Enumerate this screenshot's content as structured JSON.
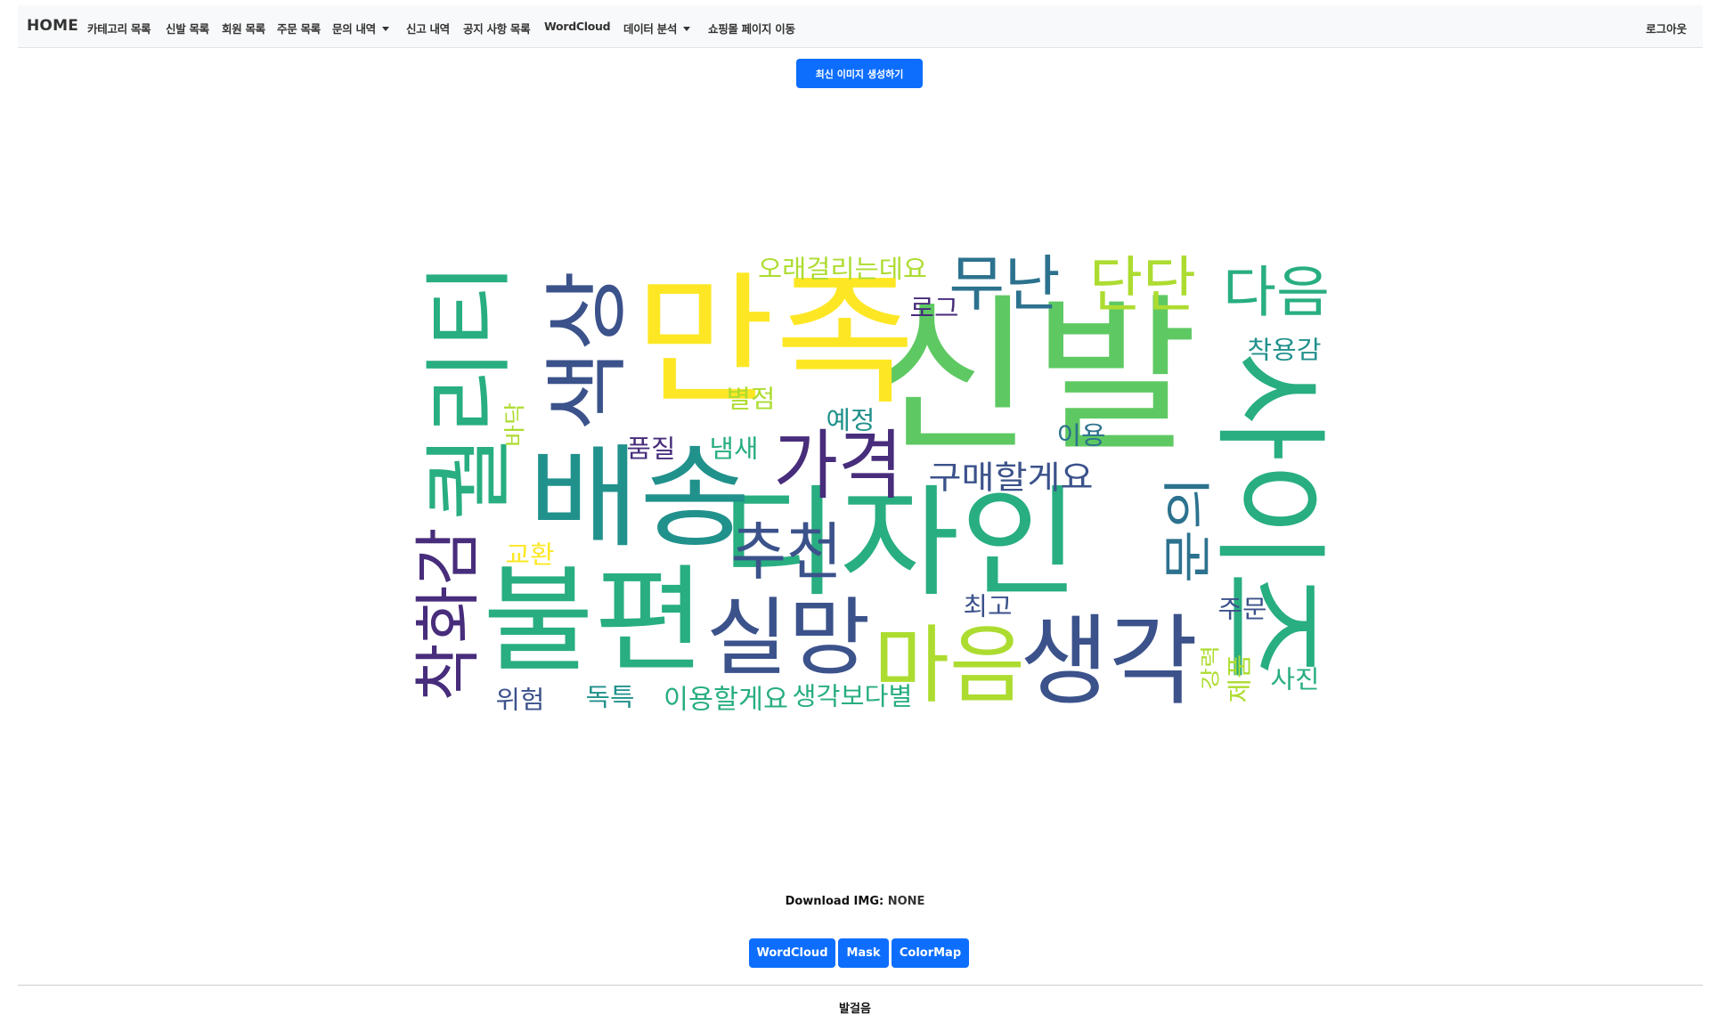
{
  "nav": {
    "brand": "HOME",
    "items": [
      {
        "label": "카테고리 목록",
        "dropdown": false
      },
      {
        "label": "신발 목록",
        "dropdown": false
      },
      {
        "label": "회원 목록",
        "dropdown": false
      },
      {
        "label": "주문 목록",
        "dropdown": false
      },
      {
        "label": "문의 내역",
        "dropdown": true
      },
      {
        "label": "신고 내역",
        "dropdown": false
      },
      {
        "label": "공지 사항 목록",
        "dropdown": false
      },
      {
        "label": "WordCloud",
        "dropdown": false
      },
      {
        "label": "데이터 분석",
        "dropdown": true
      },
      {
        "label": "쇼핑몰 페이지 이동",
        "dropdown": false
      }
    ],
    "logout": "로그아웃"
  },
  "generate_button": "최신 이미지 생성하기",
  "wordcloud": {
    "colors": {
      "purple": "#472d7b",
      "indigo": "#3b528b",
      "blue": "#2c728e",
      "teal": "#21918c",
      "green": "#28ae80",
      "lime": "#5ec962",
      "yellowgreen": "#addc30",
      "yellow": "#fde725"
    },
    "words": [
      {
        "text": "신발",
        "color": "lime"
      },
      {
        "text": "만족",
        "color": "yellow"
      },
      {
        "text": "디자인",
        "color": "green"
      },
      {
        "text": "배송",
        "color": "teal"
      },
      {
        "text": "불편",
        "color": "green"
      },
      {
        "text": "사이즈",
        "color": "green"
      },
      {
        "text": "퀄리티",
        "color": "green"
      },
      {
        "text": "생각",
        "color": "indigo"
      },
      {
        "text": "마음",
        "color": "yellowgreen"
      },
      {
        "text": "실망",
        "color": "indigo"
      },
      {
        "text": "색상",
        "color": "indigo"
      },
      {
        "text": "착화감",
        "color": "purple"
      },
      {
        "text": "가격",
        "color": "purple"
      },
      {
        "text": "추천",
        "color": "indigo"
      },
      {
        "text": "무난",
        "color": "blue"
      },
      {
        "text": "단단",
        "color": "yellowgreen"
      },
      {
        "text": "다음",
        "color": "green"
      },
      {
        "text": "문의",
        "color": "blue"
      },
      {
        "text": "구매할게요",
        "color": "indigo"
      },
      {
        "text": "오래걸리는데요",
        "color": "yellowgreen"
      },
      {
        "text": "착용감",
        "color": "teal"
      },
      {
        "text": "로그",
        "color": "purple"
      },
      {
        "text": "별점",
        "color": "yellowgreen"
      },
      {
        "text": "예정",
        "color": "teal"
      },
      {
        "text": "이용",
        "color": "blue"
      },
      {
        "text": "품질",
        "color": "purple"
      },
      {
        "text": "냄새",
        "color": "green"
      },
      {
        "text": "바닥",
        "color": "yellowgreen"
      },
      {
        "text": "교환",
        "color": "yellow"
      },
      {
        "text": "최고",
        "color": "indigo"
      },
      {
        "text": "주문",
        "color": "indigo"
      },
      {
        "text": "강력",
        "color": "yellowgreen"
      },
      {
        "text": "제품",
        "color": "yellowgreen"
      },
      {
        "text": "사진",
        "color": "green"
      },
      {
        "text": "위험",
        "color": "indigo"
      },
      {
        "text": "독특",
        "color": "teal"
      },
      {
        "text": "이용할게요",
        "color": "green"
      },
      {
        "text": "생각보다별",
        "color": "green"
      }
    ]
  },
  "download": {
    "label": "Download IMG:",
    "value": "NONE"
  },
  "buttons": {
    "wordcloud": "WordCloud",
    "mask": "Mask",
    "colormap": "ColorMap"
  },
  "footer": "발걸음"
}
